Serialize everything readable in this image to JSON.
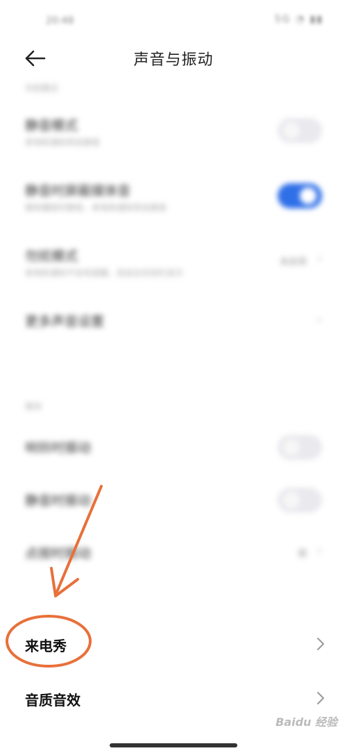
{
  "status_bar": {
    "time": "20:48",
    "icons": "5G ◔ ▮▮"
  },
  "header": {
    "title": "声音与振动"
  },
  "blurred_sections": {
    "section1_label": "勿扰模式",
    "rows": [
      {
        "title": "静音模式",
        "subtitle": "来电和通知将会静音",
        "control": "toggle",
        "on": false
      },
      {
        "title": "静音时屏蔽媒体音",
        "subtitle": "媒体播放时静音，来电和通知将会静音",
        "control": "toggle",
        "on": true
      },
      {
        "title": "勿扰模式",
        "subtitle": "来电和通知不会有提醒，但会在状态栏显示",
        "control": "value",
        "value": "未启用"
      },
      {
        "title": "更多声音设置",
        "subtitle": "",
        "control": "chevron"
      }
    ],
    "section2_label": "振动",
    "rows2": [
      {
        "title": "响铃时振动",
        "control": "toggle",
        "on": false
      },
      {
        "title": "静音时振动",
        "control": "toggle",
        "on": false
      },
      {
        "title": "点按时振动",
        "control": "value",
        "value": "弱"
      }
    ]
  },
  "items": {
    "incoming_call_show": "来电秀",
    "sound_quality": "音质音效"
  },
  "watermark": "Baidu 经验",
  "colors": {
    "toggle_on": "#2f6fe8",
    "annotation": "#e8703a"
  }
}
